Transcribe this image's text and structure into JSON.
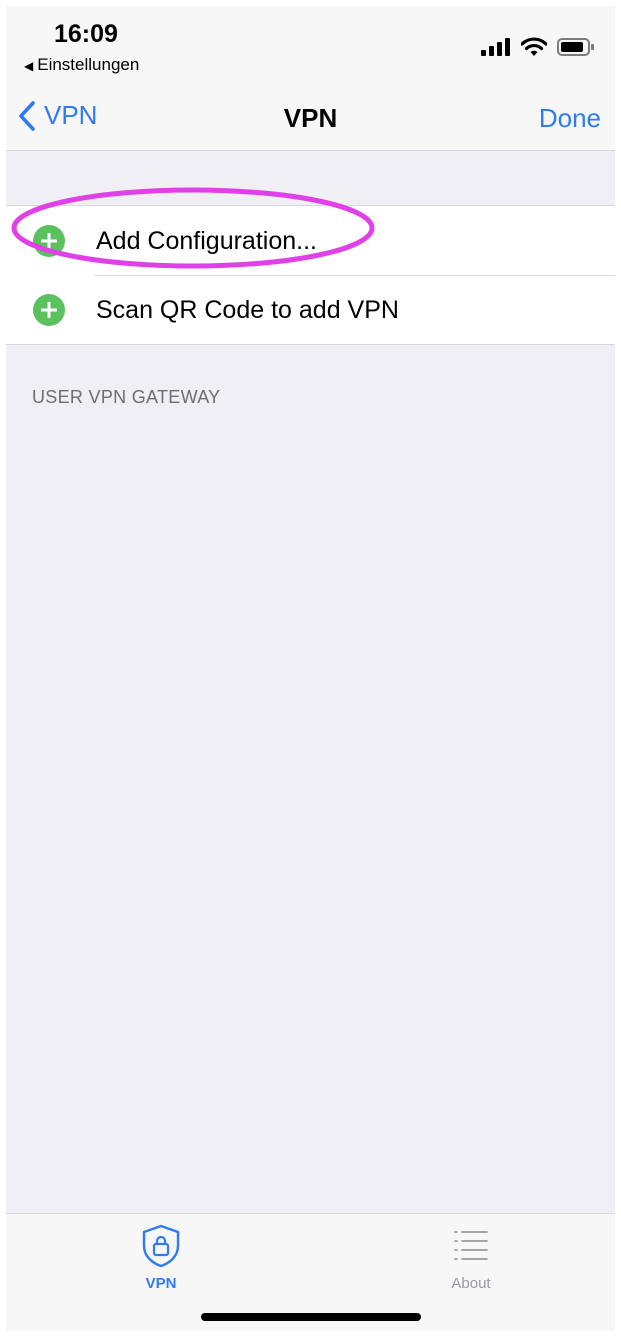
{
  "status_bar": {
    "time": "16:09",
    "back_app": "Einstellungen",
    "icons": [
      "signal-icon",
      "wifi-icon",
      "battery-icon"
    ]
  },
  "nav": {
    "back_label": "VPN",
    "title": "VPN",
    "done_label": "Done"
  },
  "actions": [
    {
      "label": "Add Configuration...",
      "icon": "plus-circle-icon",
      "highlighted": true
    },
    {
      "label": "Scan QR Code to add VPN",
      "icon": "plus-circle-icon",
      "highlighted": false
    }
  ],
  "section_header": "USER VPN GATEWAY",
  "tabs": [
    {
      "label": "VPN",
      "icon": "shield-lock-icon",
      "selected": true
    },
    {
      "label": "About",
      "icon": "list-icon",
      "selected": false
    }
  ],
  "colors": {
    "accent": "#2f7bf6",
    "add_green": "#5bc15d",
    "highlight": "#e040e8",
    "background": "#efeff4"
  }
}
